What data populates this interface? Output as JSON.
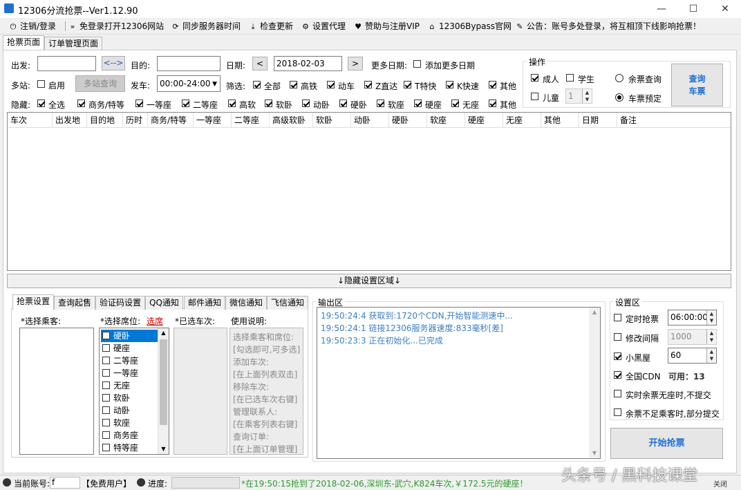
{
  "window": {
    "title": "12306分流抢票--Ver1.12.90",
    "min": "—",
    "max": "☐",
    "close": "✕"
  },
  "menu": [
    {
      "icon": "⏻",
      "label": "注销/登录"
    },
    {
      "icon": "»",
      "label": "免登录打开12306网站"
    },
    {
      "icon": "⟳",
      "label": "同步服务器时间"
    },
    {
      "icon": "⤓",
      "label": "检查更新"
    },
    {
      "icon": "⚙",
      "label": "设置代理"
    },
    {
      "icon": "♥",
      "label": "赞助与注册VIP"
    },
    {
      "icon": "⌂",
      "label": "12306Bypass官网"
    },
    {
      "icon": "✎",
      "label": "公告：账号多处登录，将互相顶下线影响抢票！"
    }
  ],
  "tabs": [
    "抢票页面",
    "订单管理页面"
  ],
  "search": {
    "from_label": "出发:",
    "to_label": "目的:",
    "swap": "<-->",
    "date_label": "日期:",
    "date_value": "2018-02-03",
    "prev": "<",
    "next": ">",
    "more_dates_label": "更多日期:",
    "add_more_dates": "添加更多日期",
    "multi_station_label": "多站:",
    "enable": "启用",
    "multi_query": "多站查询",
    "depart_label": "发车:",
    "depart_value": "00:00-24:00",
    "filter_label": "筛选:",
    "filters": [
      "全部",
      "高铁",
      "动车",
      "Z直达",
      "T特快",
      "K快速",
      "其他"
    ],
    "hide_label": "隐藏:",
    "hide_items": [
      "全选",
      "商务/特等",
      "一等座",
      "二等座",
      "高软",
      "软卧",
      "动卧",
      "硬卧",
      "软座",
      "硬座",
      "无座",
      "其他"
    ]
  },
  "operations": {
    "title": "操作",
    "adult": "成人",
    "student": "学生",
    "child": "儿童",
    "child_count": "1",
    "remaining_query": "余票查询",
    "ticket_reserve": "车票预定",
    "query_button": [
      "查询",
      "车票"
    ]
  },
  "grid": {
    "columns": [
      "车次",
      "出发地",
      "目的地",
      "历时",
      "商务/特等",
      "一等座",
      "二等座",
      "高级软卧",
      "软卧",
      "动卧",
      "硬卧",
      "软座",
      "硬座",
      "无座",
      "其他",
      "日期",
      "备注"
    ]
  },
  "hide_settings": "↓隐藏设置区域↓",
  "bottom_tabs": [
    "抢票设置",
    "查询起售",
    "验证码设置",
    "QQ通知",
    "邮件通知",
    "微信通知",
    "飞信通知"
  ],
  "settings_tab": {
    "passenger_label": "*选择乘客:",
    "seat_label": "*选择席位:",
    "seat_link": "选席",
    "train_label": "*已选车次:",
    "usage_label": "使用说明:",
    "seats": [
      "硬卧",
      "硬座",
      "二等座",
      "一等座",
      "无座",
      "软卧",
      "动卧",
      "软座",
      "商务座",
      "特等座"
    ],
    "usage_lines": [
      "选择乘客和席位:",
      "[勾选即可,可多选]",
      "添加车次:",
      "[在上面列表双击]",
      "移除车次:",
      "[在已选车次右键]",
      "管理联系人:",
      "[在乘客列表右键]",
      "查询订单:",
      "[在上面订单管理]"
    ]
  },
  "output": {
    "title": "输出区",
    "lines": [
      "19:50:24:4   获取到:1720个CDN,开始智能测速中...",
      "19:50:24:1   链接12306服务器速度:833毫秒[差]",
      "19:50:23:3   正在初始化...已完成"
    ]
  },
  "settings_area": {
    "title": "设置区",
    "timed_grab": "定时抢票",
    "timed_value": "06:00:00",
    "modify_interval": "修改间隔",
    "interval_value": "1000",
    "blackroom": "小黑屋",
    "blackroom_value": "60",
    "national_cdn": "全国CDN",
    "available": "可用：13",
    "no_seat_skip": "实时余票无座时,不提交",
    "partial_submit": "余票不足乘客时,部分提交",
    "start_button": "开始抢票"
  },
  "status": {
    "account_label": "当前账号:",
    "account_value": "f",
    "user_type": "【免费用户】",
    "progress_label": "进度:",
    "message": "*在19:50:15抢到了2018-02-06,深圳东-武穴,K824车次,￥172.5元的硬座！",
    "watermark": "头条号 / 黑科技课堂",
    "tail": "关闭"
  }
}
